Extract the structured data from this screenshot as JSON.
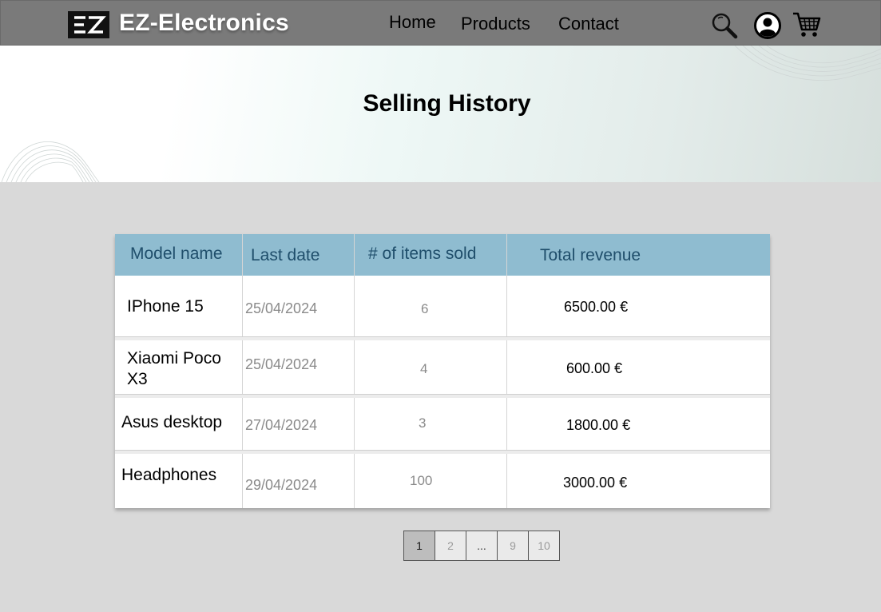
{
  "navbar": {
    "brand": "EZ-Electronics",
    "links": [
      "Home",
      "Products",
      "Contact"
    ],
    "icons": [
      "search-icon",
      "user-icon",
      "cart-icon"
    ]
  },
  "hero": {
    "title": "Selling History"
  },
  "table": {
    "headers": [
      "Model name",
      "Last date",
      "# of items sold",
      "Total revenue"
    ],
    "rows": [
      {
        "model": "IPhone 15",
        "date": "25/04/2024",
        "qty": "6",
        "revenue": "6500.00 €"
      },
      {
        "model": "Xiaomi Poco X3",
        "date": "25/04/2024",
        "qty": "4",
        "revenue": "600.00 €"
      },
      {
        "model": "Asus desktop",
        "date": "27/04/2024",
        "qty": "3",
        "revenue": "1800.00 €"
      },
      {
        "model": "Headphones",
        "date": "29/04/2024",
        "qty": "100",
        "revenue": "3000.00 €"
      }
    ]
  },
  "pagination": {
    "pages": [
      "1",
      "2",
      "...",
      "9",
      "10"
    ],
    "current": "1"
  },
  "colors": {
    "navbar": "#7a7a7a",
    "table_header": "#8fbcd0",
    "header_text": "#1f4e6b",
    "page_bg": "#d9d9d9"
  }
}
